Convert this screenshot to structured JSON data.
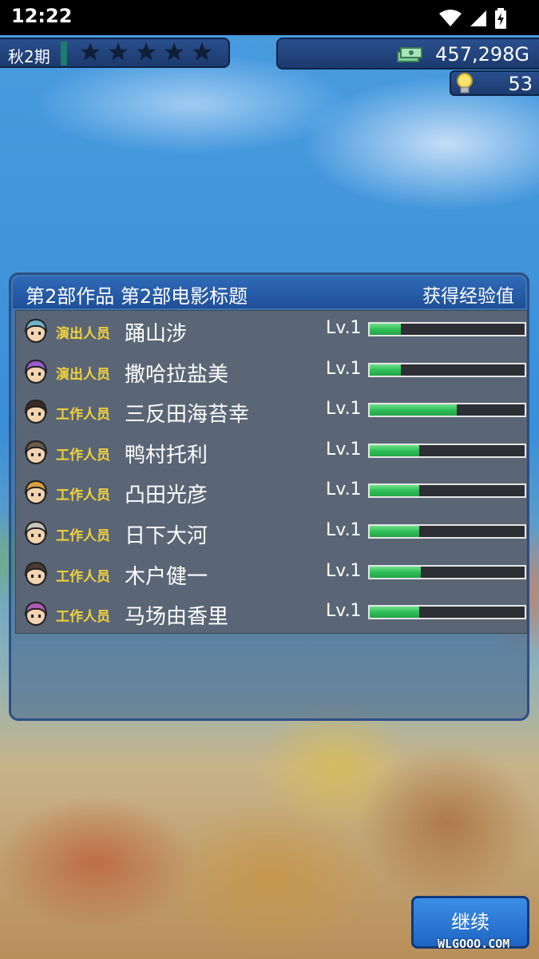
{
  "status_bar": {
    "time": "12:22"
  },
  "hud": {
    "season": "秋2期",
    "stars_count": 5,
    "money": "457,298G",
    "ideas": "53"
  },
  "panel": {
    "title": "第2部作品 第2部电影标题",
    "exp_label": "获得经验值",
    "rows": [
      {
        "role": "演出人员",
        "name": "踊山涉",
        "level": "Lv.1",
        "progress": 0.2,
        "avatar_hair": "#6fb2c8"
      },
      {
        "role": "演出人员",
        "name": "撒哈拉盐美",
        "level": "Lv.1",
        "progress": 0.2,
        "avatar_hair": "#9a5ad0"
      },
      {
        "role": "工作人员",
        "name": "三反田海苔幸",
        "level": "Lv.1",
        "progress": 0.56,
        "avatar_hair": "#3a2a24"
      },
      {
        "role": "工作人员",
        "name": "鸭村托利",
        "level": "Lv.1",
        "progress": 0.32,
        "avatar_hair": "#6a5a4a"
      },
      {
        "role": "工作人员",
        "name": "凸田光彦",
        "level": "Lv.1",
        "progress": 0.32,
        "avatar_hair": "#d9a040"
      },
      {
        "role": "工作人员",
        "name": "日下大河",
        "level": "Lv.1",
        "progress": 0.32,
        "avatar_hair": "#c9c3bd"
      },
      {
        "role": "工作人员",
        "name": "木户健一",
        "level": "Lv.1",
        "progress": 0.33,
        "avatar_hair": "#4a3a32"
      },
      {
        "role": "工作人员",
        "name": "马场由香里",
        "level": "Lv.1",
        "progress": 0.32,
        "avatar_hair": "#b05ab8"
      }
    ]
  },
  "continue_button": {
    "label": "继续"
  },
  "watermark": {
    "text": "WLGOOO.COM"
  },
  "colors": {
    "role_text": "#f2d23c",
    "bar_fill": "#2fbf58",
    "panel_header": "#2f6ab8"
  }
}
